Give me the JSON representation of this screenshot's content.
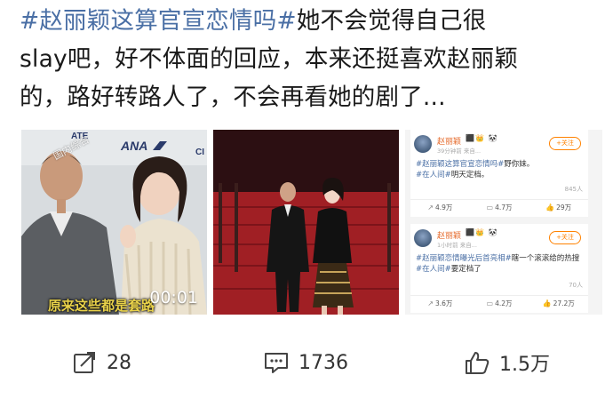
{
  "post": {
    "hashtag": "#赵丽颖这算官宣恋情吗#",
    "line1_rest": "她不会觉得自己很",
    "line2": "slay吧，好不体面的回应，本来还挺喜欢赵丽颖",
    "line3": "的，路好转路人了，不会再看她的剧了..."
  },
  "media": {
    "image1": {
      "brand_text": "ANA",
      "backdrop_small": "ATE",
      "backdrop_side": "CI",
      "watermark": "国内综合",
      "caption": "原来这些都是套路",
      "timestamp": "00:01"
    },
    "image3": {
      "cards": [
        {
          "username": "赵丽颖",
          "badges": "⬛👑 🐼",
          "meta": "39分钟前 来自...",
          "follow": "+关注",
          "hashtag": "#赵丽颖这算官宣恋情吗#",
          "text": "野你妹。",
          "tag2": "#在人间#",
          "text2": "明天定档。",
          "stat": "845人",
          "repost": "4.9万",
          "comment": "4.7万",
          "like": "29万"
        },
        {
          "username": "赵丽颖",
          "badges": "⬛👑 🐼",
          "meta": "1小时前 来自...",
          "follow": "+关注",
          "hashtag": "#赵丽颖恋情曝光后首亮相#",
          "text": "瞎一个滚滚给的热搜",
          "tag2": "#在人间#",
          "text2": "要定档了",
          "stat": "70人",
          "repost": "3.6万",
          "comment": "4.2万",
          "like": "27.2万"
        }
      ]
    }
  },
  "footer": {
    "share_count": "28",
    "comment_count": "1736",
    "like_count": "1.5万"
  },
  "colors": {
    "hashtag": "#4a6fa5",
    "text": "#1a1a1a",
    "caption_yellow": "#e9d24a",
    "follow_orange": "#ff8200"
  },
  "icons": [
    "share-icon",
    "comment-icon",
    "like-icon",
    "repost-icon"
  ]
}
